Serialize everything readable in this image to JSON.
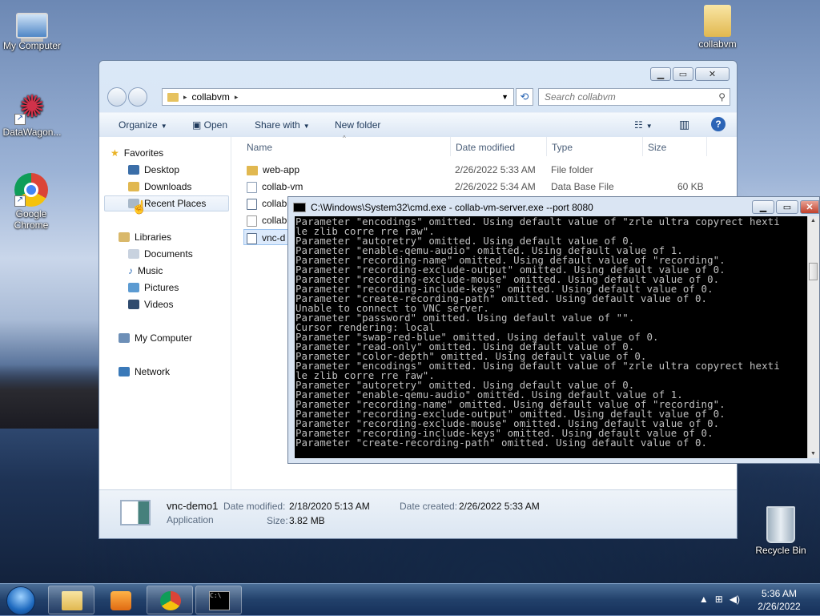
{
  "desktop": {
    "icons": [
      {
        "label": "My Computer",
        "icon": "computer-icon"
      },
      {
        "label": "DataWagon...",
        "icon": "datawagon-icon"
      },
      {
        "label": "Google Chrome",
        "icon": "chrome-icon"
      },
      {
        "label": "collabvm",
        "icon": "folder-icon"
      },
      {
        "label": "Recycle Bin",
        "icon": "recycle-bin-icon"
      }
    ]
  },
  "explorer": {
    "address": {
      "root_sep": "▸",
      "path": "collabvm",
      "trail_sep": "▸"
    },
    "search_placeholder": "Search collabvm",
    "toolbar": {
      "organize": "Organize",
      "open": "Open",
      "share_with": "Share with",
      "new_folder": "New folder"
    },
    "nav": {
      "favorites": "Favorites",
      "desktop": "Desktop",
      "downloads": "Downloads",
      "recent_places": "Recent Places",
      "libraries": "Libraries",
      "documents": "Documents",
      "music": "Music",
      "pictures": "Pictures",
      "videos": "Videos",
      "my_computer": "My Computer",
      "network": "Network"
    },
    "columns": {
      "name": "Name",
      "date_modified": "Date modified",
      "type": "Type",
      "size": "Size"
    },
    "files": [
      {
        "name": "web-app",
        "date": "2/26/2022 5:33 AM",
        "type": "File folder",
        "size": ""
      },
      {
        "name": "collab-vm",
        "date": "2/26/2022 5:34 AM",
        "type": "Data Base File",
        "size": "60 KB"
      },
      {
        "name": "collab",
        "date": "",
        "type": "",
        "size": ""
      },
      {
        "name": "collab",
        "date": "",
        "type": "",
        "size": ""
      },
      {
        "name": "vnc-d",
        "date": "",
        "type": "",
        "size": ""
      }
    ],
    "details": {
      "name": "vnc-demo1",
      "type": "Application",
      "date_modified_label": "Date modified:",
      "date_modified": "2/18/2020 5:13 AM",
      "date_created_label": "Date created:",
      "date_created": "2/26/2022 5:33 AM",
      "size_label": "Size:",
      "size": "3.82 MB"
    }
  },
  "cmd": {
    "title": "C:\\Windows\\System32\\cmd.exe - collab-vm-server.exe  --port 8080",
    "output": "Parameter \"encodings\" omitted. Using default value of \"zrle ultra copyrect hexti\nle zlib corre rre raw\".\nParameter \"autoretry\" omitted. Using default value of 0.\nParameter \"enable-qemu-audio\" omitted. Using default value of 1.\nParameter \"recording-name\" omitted. Using default value of \"recording\".\nParameter \"recording-exclude-output\" omitted. Using default value of 0.\nParameter \"recording-exclude-mouse\" omitted. Using default value of 0.\nParameter \"recording-include-keys\" omitted. Using default value of 0.\nParameter \"create-recording-path\" omitted. Using default value of 0.\nUnable to connect to VNC server.\nParameter \"password\" omitted. Using default value of \"\".\nCursor rendering: local\nParameter \"swap-red-blue\" omitted. Using default value of 0.\nParameter \"read-only\" omitted. Using default value of 0.\nParameter \"color-depth\" omitted. Using default value of 0.\nParameter \"encodings\" omitted. Using default value of \"zrle ultra copyrect hexti\nle zlib corre rre raw\".\nParameter \"autoretry\" omitted. Using default value of 0.\nParameter \"enable-qemu-audio\" omitted. Using default value of 1.\nParameter \"recording-name\" omitted. Using default value of \"recording\".\nParameter \"recording-exclude-output\" omitted. Using default value of 0.\nParameter \"recording-exclude-mouse\" omitted. Using default value of 0.\nParameter \"recording-include-keys\" omitted. Using default value of 0.\nParameter \"create-recording-path\" omitted. Using default value of 0."
  },
  "taskbar": {
    "time": "5:36 AM",
    "date": "2/26/2022",
    "pinned": [
      "explorer-icon",
      "media-player-icon",
      "chrome-icon",
      "cmd-icon"
    ]
  }
}
